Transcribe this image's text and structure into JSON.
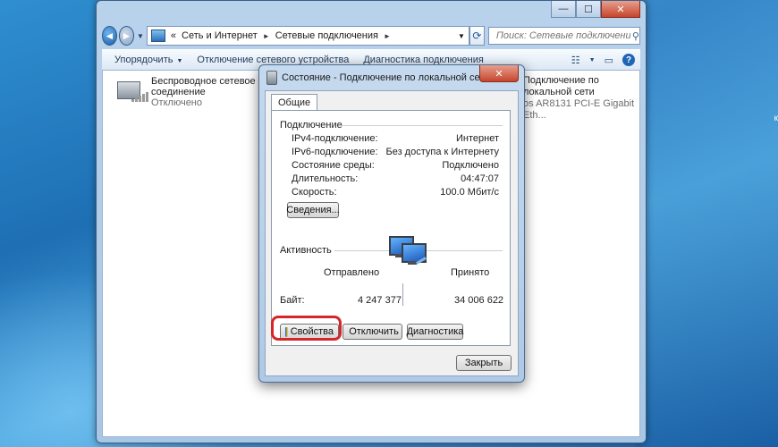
{
  "explorer": {
    "window_controls": {
      "minimize": "—",
      "maximize": "☐",
      "close": "✕"
    },
    "breadcrumb": {
      "prefix": "«",
      "level1": "Сеть и Интернет",
      "level2": "Сетевые подключения"
    },
    "search_placeholder": "Поиск: Сетевые подключения",
    "commands": {
      "organize": "Упорядочить",
      "disable": "Отключение сетевого устройства",
      "diagnose": "Диагностика подключения"
    },
    "connections": [
      {
        "name_line1": "Беспроводное сетевое",
        "name_line2": "соединение",
        "status": "Отключено"
      },
      {
        "name_line1": "Подключение по локальной сети",
        "device": "os AR8131 PCI-E Gigabit Eth..."
      }
    ]
  },
  "dialog": {
    "title": "Состояние - Подключение по локальной сети",
    "close_symbol": "✕",
    "tab": "Общие",
    "connection_group": "Подключение",
    "fields": [
      {
        "label": "IPv4-подключение:",
        "value": "Интернет"
      },
      {
        "label": "IPv6-подключение:",
        "value": "Без доступа к Интернету"
      },
      {
        "label": "Состояние среды:",
        "value": "Подключено"
      },
      {
        "label": "Длительность:",
        "value": "04:47:07"
      },
      {
        "label": "Скорость:",
        "value": "100.0 Мбит/с"
      }
    ],
    "details_button": "Сведения...",
    "activity_group": "Активность",
    "sent_label": "Отправлено",
    "received_label": "Принято",
    "bytes_label": "Байт:",
    "bytes_sent": "4 247 377",
    "bytes_received": "34 006 622",
    "properties_button": "Свойства",
    "disable_button": "Отключить",
    "diagnose_button": "Диагностика",
    "close_button": "Закрыть"
  },
  "desktop": {
    "edge_text": "к"
  }
}
